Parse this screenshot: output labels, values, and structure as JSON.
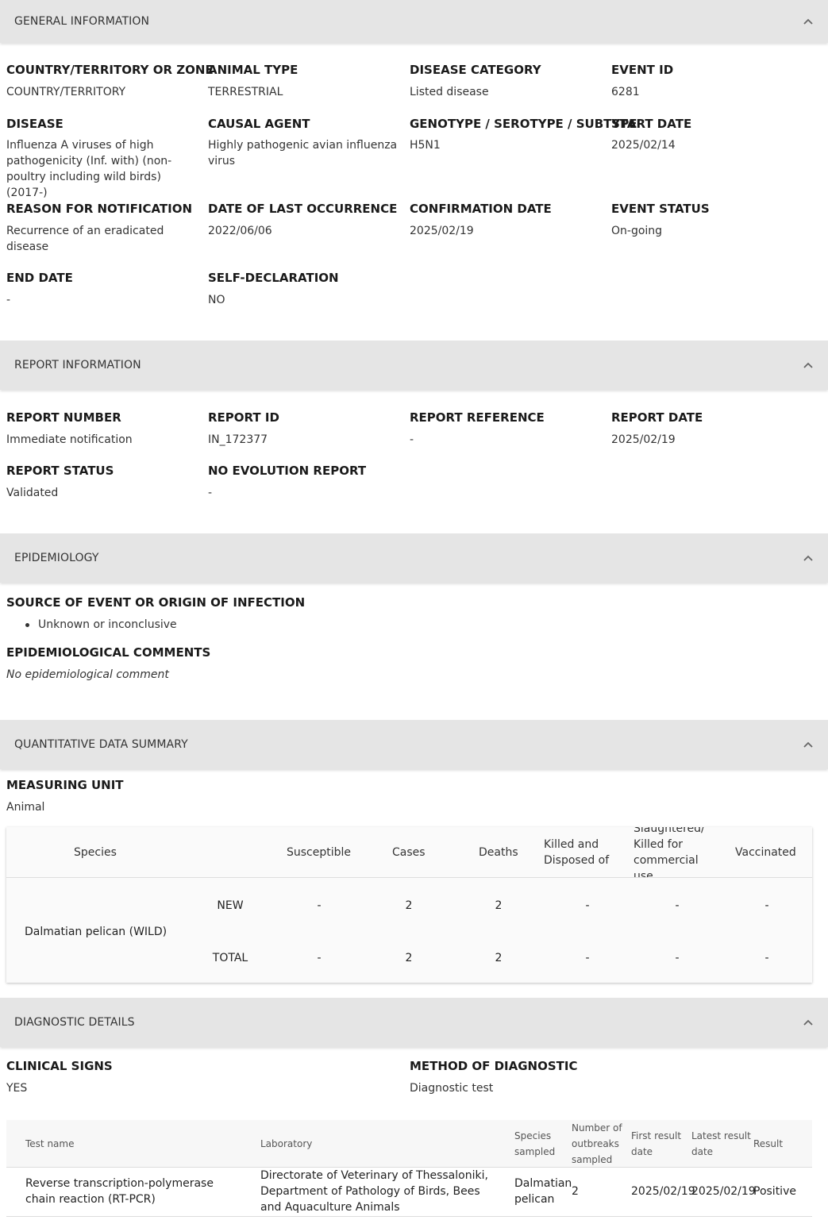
{
  "general": {
    "title": "GENERAL INFORMATION",
    "fields": [
      {
        "label": "COUNTRY/TERRITORY OR ZONE",
        "value": "COUNTRY/TERRITORY"
      },
      {
        "label": "ANIMAL TYPE",
        "value": "TERRESTRIAL"
      },
      {
        "label": "DISEASE CATEGORY",
        "value": "Listed disease"
      },
      {
        "label": "EVENT ID",
        "value": "6281"
      },
      {
        "label": "DISEASE",
        "value": "Influenza A viruses of high pathogenicity (Inf. with) (non-poultry including wild birds) (2017-)"
      },
      {
        "label": "CAUSAL AGENT",
        "value": "Highly pathogenic avian influenza virus"
      },
      {
        "label": "GENOTYPE / SEROTYPE / SUBTYPE",
        "value": "H5N1"
      },
      {
        "label": "START DATE",
        "value": "2025/02/14"
      },
      {
        "label": "REASON FOR NOTIFICATION",
        "value": "Recurrence of an eradicated disease"
      },
      {
        "label": "DATE OF LAST OCCURRENCE",
        "value": "2022/06/06"
      },
      {
        "label": "CONFIRMATION DATE",
        "value": "2025/02/19"
      },
      {
        "label": "EVENT STATUS",
        "value": "On-going"
      },
      {
        "label": "END DATE",
        "value": "-"
      },
      {
        "label": "SELF-DECLARATION",
        "value": "NO"
      }
    ]
  },
  "report": {
    "title": "REPORT INFORMATION",
    "fields": [
      {
        "label": "REPORT NUMBER",
        "value": "Immediate notification"
      },
      {
        "label": "REPORT ID",
        "value": "IN_172377"
      },
      {
        "label": "REPORT REFERENCE",
        "value": "-"
      },
      {
        "label": "REPORT DATE",
        "value": "2025/02/19"
      },
      {
        "label": "REPORT STATUS",
        "value": "Validated"
      },
      {
        "label": "NO EVOLUTION REPORT",
        "value": "-"
      }
    ]
  },
  "epidemiology": {
    "title": "EPIDEMIOLOGY",
    "source_label": "SOURCE OF EVENT OR ORIGIN OF INFECTION",
    "sources": [
      "Unknown or inconclusive"
    ],
    "comments_label": "EPIDEMIOLOGICAL COMMENTS",
    "comments_value": "No epidemiological comment"
  },
  "quantitative": {
    "title": "QUANTITATIVE DATA SUMMARY",
    "unit_label": "MEASURING UNIT",
    "unit_value": "Animal",
    "headers": {
      "species": "Species",
      "susceptible": "Susceptible",
      "cases": "Cases",
      "deaths": "Deaths",
      "killed": "Killed and Disposed of",
      "slaughtered": "Slaughtered/ Killed for commercial use",
      "vaccinated": "Vaccinated"
    },
    "species": "Dalmatian pelican (WILD)",
    "rows": [
      {
        "type": "NEW",
        "susceptible": "-",
        "cases": "2",
        "deaths": "2",
        "killed": "-",
        "slaughtered": "-",
        "vaccinated": "-"
      },
      {
        "type": "TOTAL",
        "susceptible": "-",
        "cases": "2",
        "deaths": "2",
        "killed": "-",
        "slaughtered": "-",
        "vaccinated": "-"
      }
    ]
  },
  "diagnostic": {
    "title": "DIAGNOSTIC DETAILS",
    "clinical_label": "CLINICAL SIGNS",
    "clinical_value": "YES",
    "method_label": "METHOD OF DIAGNOSTIC",
    "method_value": "Diagnostic test",
    "headers": {
      "test_name": "Test name",
      "laboratory": "Laboratory",
      "species": "Species sampled",
      "outbreaks": "Number of outbreaks sampled",
      "first": "First result date",
      "latest": "Latest result date",
      "result": "Result"
    },
    "rows": [
      {
        "test_name": "Reverse transcription-polymerase chain reaction (RT-PCR)",
        "laboratory": "Directorate of Veterinary of Thessaloniki, Department of Pathology of Birds, Bees and Aquaculture Animals",
        "species": "Dalmatian pelican",
        "outbreaks": "2",
        "first": "2025/02/19",
        "latest": "2025/02/19",
        "result": "Positive"
      }
    ]
  }
}
